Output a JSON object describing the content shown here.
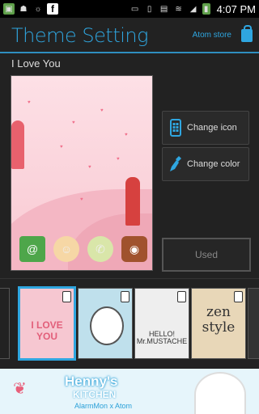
{
  "status_bar": {
    "time": "4:07 PM",
    "facebook_letter": "f"
  },
  "header": {
    "title": "Theme Setting",
    "store_label": "Atom store"
  },
  "theme": {
    "name": "I Love You"
  },
  "actions": {
    "change_icon": "Change icon",
    "change_color": "Change color",
    "used": "Used"
  },
  "thumbnails": [
    {
      "id": "love",
      "label": "I LOVE YOU",
      "selected": true
    },
    {
      "id": "chef",
      "label": "",
      "selected": false
    },
    {
      "id": "mustache",
      "label": "HELLO! Mr.MUSTACHE",
      "selected": false
    },
    {
      "id": "zen",
      "label": "zen style",
      "selected": false
    }
  ],
  "ad": {
    "title": "Henny's",
    "subtitle": "KITCHEN",
    "footer": "AlarmMon x Atom"
  },
  "colors": {
    "accent": "#2fa6e0",
    "background": "#222222",
    "preview_pink": "#f8c9d2"
  }
}
